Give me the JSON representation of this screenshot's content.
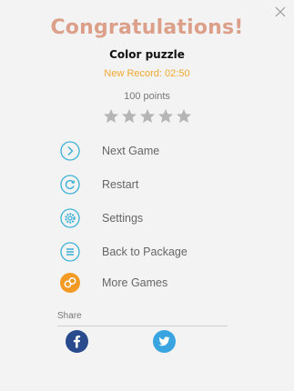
{
  "dialog": {
    "title": "Congratulations!",
    "game_name": "Color puzzle",
    "record": "New Record: 02:50",
    "points": "100 points",
    "stars": {
      "earned": 0,
      "total": 5
    }
  },
  "menu": {
    "items": [
      {
        "label": "Next Game",
        "icon": "next-arrow-icon"
      },
      {
        "label": "Restart",
        "icon": "restart-icon"
      },
      {
        "label": "Settings",
        "icon": "gear-icon"
      },
      {
        "label": "Back to Package",
        "icon": "list-icon"
      },
      {
        "label": "More Games",
        "icon": "gamepad-icon"
      }
    ]
  },
  "share": {
    "label": "Share",
    "networks": [
      {
        "name": "facebook",
        "icon": "facebook-icon"
      },
      {
        "name": "twitter",
        "icon": "twitter-icon"
      }
    ]
  },
  "colors": {
    "title": "#dca08a",
    "record": "#f0a830",
    "menu_icon": "#3ab0d6",
    "more_games_icon": "#f39a24",
    "facebook": "#2a4a8e",
    "twitter": "#3aa4e0",
    "star_empty": "#b5b5b5"
  }
}
